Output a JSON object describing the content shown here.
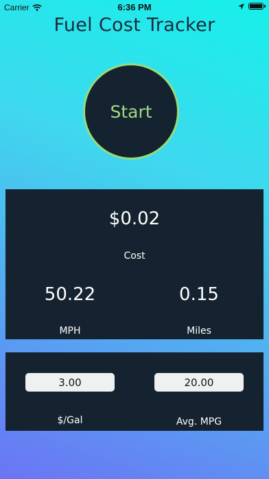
{
  "status_bar": {
    "carrier": "Carrier",
    "time": "6:36 PM",
    "icons": [
      "wifi-icon",
      "location-arrow-icon",
      "battery-icon"
    ]
  },
  "app": {
    "title": "Fuel Cost Tracker"
  },
  "start_button": {
    "label": "Start"
  },
  "stats": {
    "cost_value": "$0.02",
    "cost_label": "Cost",
    "mph_value": "50.22",
    "mph_label": "MPH",
    "miles_value": "0.15",
    "miles_label": "Miles"
  },
  "settings": {
    "price_value": "3.00",
    "price_label": "$/Gal",
    "mpg_value": "20.00",
    "mpg_label": "Avg. MPG"
  },
  "colors": {
    "panel_bg": "#14232f",
    "start_ring": "#93dd7e",
    "start_text": "#a2d885",
    "gradient_top": "#16f0ea",
    "gradient_bottom": "#6b74f4"
  }
}
